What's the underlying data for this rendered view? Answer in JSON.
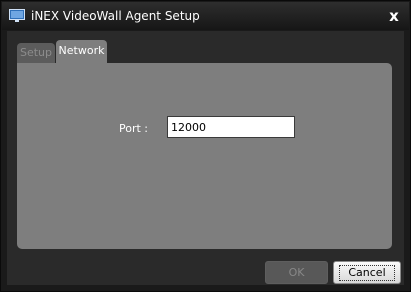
{
  "window": {
    "title": "iNEX VideoWall Agent Setup",
    "close_glyph": "x",
    "icon": "monitor-icon"
  },
  "tabs": [
    {
      "label": "Setup",
      "selected": false
    },
    {
      "label": "Network",
      "selected": true
    }
  ],
  "network": {
    "port_label": "Port :",
    "port_value": "12000"
  },
  "buttons": {
    "ok_label": "OK",
    "ok_enabled": false,
    "cancel_label": "Cancel"
  },
  "colors": {
    "titlebar": "#1e1e1e",
    "client_bg": "#2a2a2a",
    "panel_bg": "#7e7e7e",
    "inactive_tab": "#5c5c5c"
  }
}
